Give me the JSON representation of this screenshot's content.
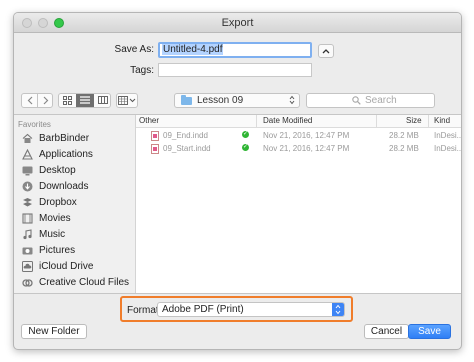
{
  "window": {
    "title": "Export"
  },
  "form": {
    "save_as_label": "Save As:",
    "save_as_value": "Untitled-4.pdf",
    "tags_label": "Tags:",
    "tags_value": ""
  },
  "toolbar": {
    "back_icon": "chevron-left-icon",
    "forward_icon": "chevron-right-icon",
    "view_icons": [
      "icon-view-icon",
      "list-view-icon",
      "column-view-icon",
      "cover-flow-icon"
    ],
    "location": "Lesson 09",
    "search_placeholder": "Search"
  },
  "sidebar": {
    "heading": "Favorites",
    "items": [
      {
        "label": "BarbBinder",
        "icon": "home-icon"
      },
      {
        "label": "Applications",
        "icon": "applications-icon"
      },
      {
        "label": "Desktop",
        "icon": "desktop-icon"
      },
      {
        "label": "Downloads",
        "icon": "downloads-icon"
      },
      {
        "label": "Dropbox",
        "icon": "dropbox-icon"
      },
      {
        "label": "Movies",
        "icon": "movies-icon"
      },
      {
        "label": "Music",
        "icon": "music-icon"
      },
      {
        "label": "Pictures",
        "icon": "pictures-icon"
      },
      {
        "label": "iCloud Drive",
        "icon": "cloud-icon"
      },
      {
        "label": "Creative Cloud Files",
        "icon": "creative-cloud-icon"
      }
    ]
  },
  "filelist": {
    "columns": [
      "Other",
      "Date Modified",
      "Size",
      "Kind"
    ],
    "rows": [
      {
        "name": "09_End.indd",
        "date": "Nov 21, 2016, 12:47 PM",
        "size": "28.2 MB",
        "kind": "InDesi..."
      },
      {
        "name": "09_Start.indd",
        "date": "Nov 21, 2016, 12:47 PM",
        "size": "28.2 MB",
        "kind": "InDesi..."
      }
    ]
  },
  "format": {
    "label": "Format:",
    "value": "Adobe PDF (Print)"
  },
  "buttons": {
    "new_folder": "New Folder",
    "cancel": "Cancel",
    "save": "Save"
  },
  "colors": {
    "accent": "#3d84f5",
    "highlight_border": "#f07d2b",
    "check_green": "#2fb534"
  }
}
